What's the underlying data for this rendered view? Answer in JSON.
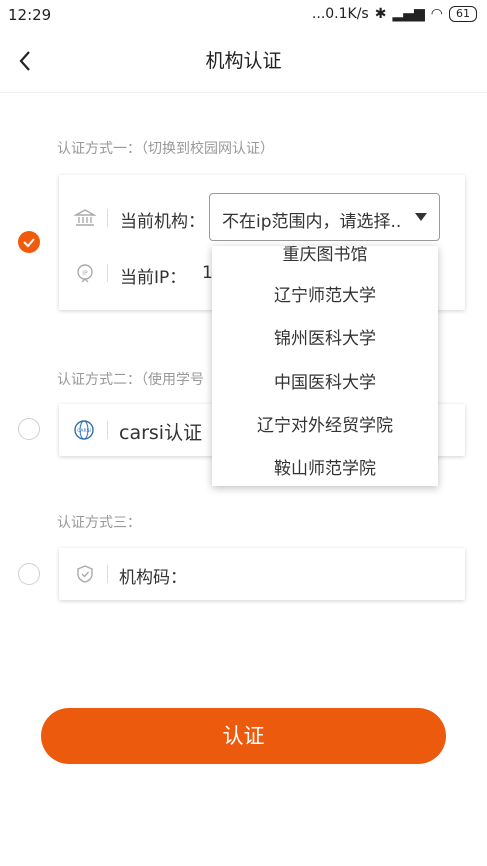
{
  "status_bar": {
    "time": "12:29",
    "network_speed": "...0.1K/s",
    "battery": "61"
  },
  "nav": {
    "title": "机构认证"
  },
  "method1": {
    "label": "认证方式一：（切换到校园网认证）",
    "institution_label": "当前机构：",
    "select_value": "不在ip范围内，请选择..",
    "ip_label": "当前IP：",
    "ip_value": "1"
  },
  "dropdown": {
    "options": [
      "重庆图书馆",
      "辽宁师范大学",
      "锦州医科大学",
      "中国医科大学",
      "辽宁对外经贸学院",
      "鞍山师范学院"
    ]
  },
  "method2": {
    "label": "认证方式二：（使用学号",
    "carsi_logo_text": "CARSI",
    "item_label": "carsi认证"
  },
  "method3": {
    "label": "认证方式三：",
    "code_label": "机构码："
  },
  "submit": {
    "label": "认证"
  },
  "colors": {
    "accent": "#ec5a0e"
  }
}
